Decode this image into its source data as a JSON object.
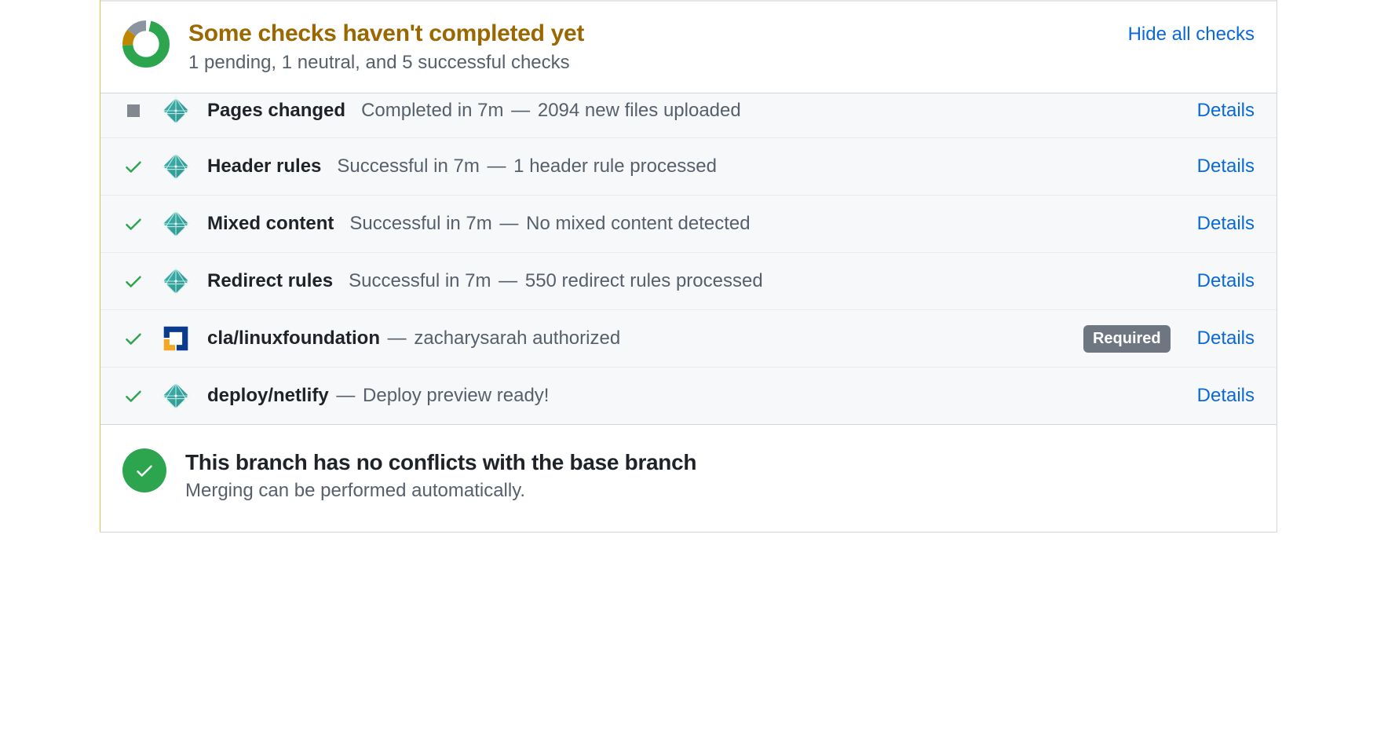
{
  "colors": {
    "pending": "#9a6700",
    "link": "#0969da",
    "success": "#2da44e",
    "muted": "#57606a"
  },
  "header": {
    "title": "Some checks haven't completed yet",
    "subtitle": "1 pending, 1 neutral, and 5 successful checks",
    "toggle_label": "Hide all checks"
  },
  "checks": [
    {
      "status": "neutral",
      "app": "netlify",
      "name": "Pages changed",
      "before": "Completed in 7m",
      "summary": "2094 new files uploaded",
      "required": false,
      "details_label": "Details",
      "partial_top": true
    },
    {
      "status": "success",
      "app": "netlify",
      "name": "Header rules",
      "before": "Successful in 7m",
      "summary": "1 header rule processed",
      "required": false,
      "details_label": "Details"
    },
    {
      "status": "success",
      "app": "netlify",
      "name": "Mixed content",
      "before": "Successful in 7m",
      "summary": "No mixed content detected",
      "required": false,
      "details_label": "Details"
    },
    {
      "status": "success",
      "app": "netlify",
      "name": "Redirect rules",
      "before": "Successful in 7m",
      "summary": "550 redirect rules processed",
      "required": false,
      "details_label": "Details"
    },
    {
      "status": "success",
      "app": "linux-foundation",
      "name": "cla/linuxfoundation",
      "before": "",
      "summary": "zacharysarah authorized",
      "required": true,
      "required_label": "Required",
      "details_label": "Details"
    },
    {
      "status": "success",
      "app": "netlify",
      "name": "deploy/netlify",
      "before": "",
      "summary": "Deploy preview ready!",
      "required": false,
      "details_label": "Details"
    }
  ],
  "merge": {
    "title": "This branch has no conflicts with the base branch",
    "subtitle": "Merging can be performed automatically."
  }
}
